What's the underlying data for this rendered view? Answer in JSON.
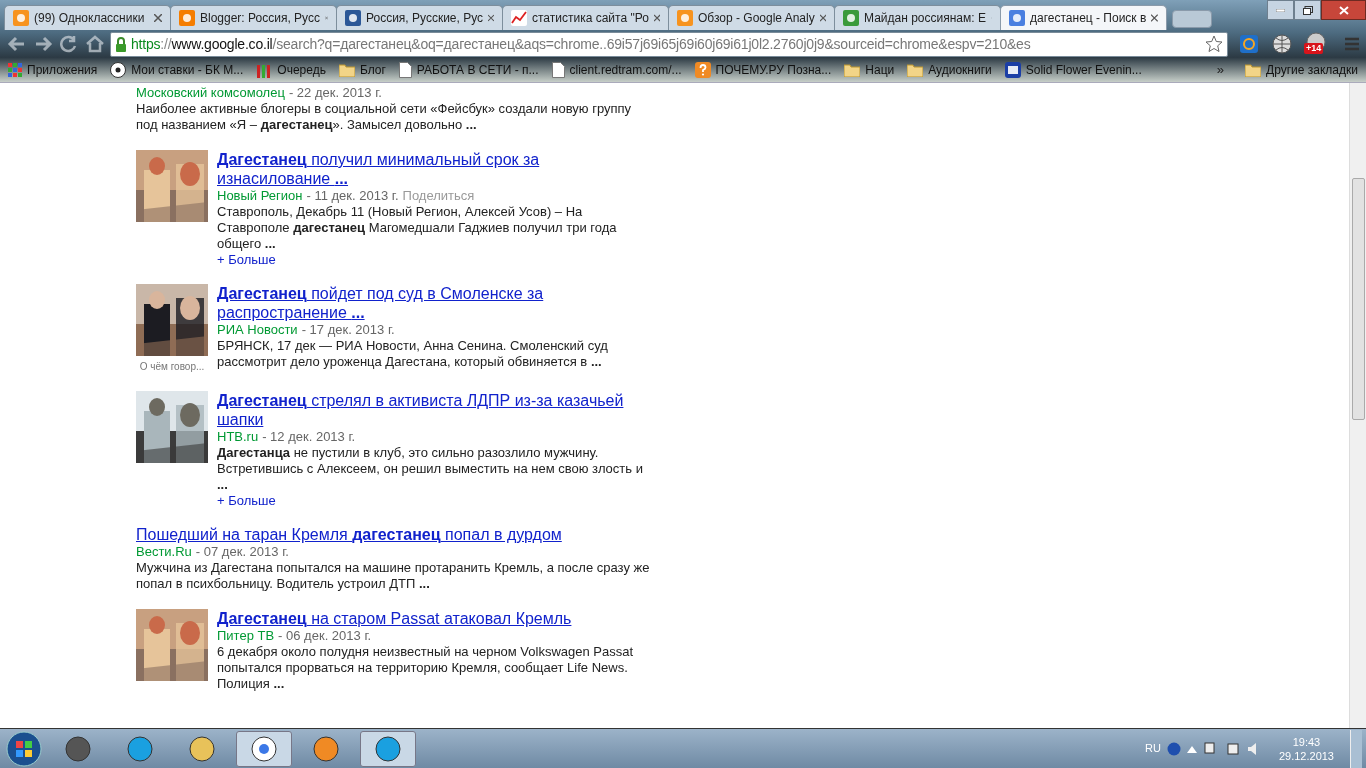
{
  "tabs": [
    {
      "title": "(99) Одноклассники",
      "selected": false
    },
    {
      "title": "Blogger: Россия, Русс",
      "selected": false
    },
    {
      "title": "Россия, Русские, Рус",
      "selected": false
    },
    {
      "title": "статистика сайта \"Ро",
      "selected": false
    },
    {
      "title": "Обзор - Google Analy",
      "selected": false
    },
    {
      "title": "Майдан россиянам: Е",
      "selected": false
    },
    {
      "title": "дагестанец - Поиск в",
      "selected": true
    }
  ],
  "address": {
    "scheme": "https",
    "separator": "://",
    "host": "www.google.co.il",
    "path": "/search?q=дагестанец&oq=дагестанец&aqs=chrome..69i57j69i65j69i60j69i61j0l2.2760j0j9&sourceid=chrome&espv=210&es"
  },
  "extension_badge": "+14",
  "bookmarks": [
    {
      "label": "Приложения"
    },
    {
      "label": "Мои ставки - БК М..."
    },
    {
      "label": "Очередь"
    },
    {
      "label": "Блог"
    },
    {
      "label": "РАБОТА В СЕТИ - п..."
    },
    {
      "label": "client.redtram.com/..."
    },
    {
      "label": "ПОЧЕМУ.РУ Позна..."
    },
    {
      "label": "Наци"
    },
    {
      "label": "Аудиокниги"
    },
    {
      "label": "Solid Flower Evenin..."
    }
  ],
  "bookmarks_more": "»",
  "other_bookmarks": "Другие закладки",
  "results": [
    {
      "source": "Московский комсомолец",
      "date": "- 22 дек. 2013 г.",
      "snippet": "Наиболее активные блогеры в социальной сети «Фейсбук» создали новую группу под названием «Я – **дагестанец**». Замысел довольно **...**"
    },
    {
      "thumbnail": true,
      "title": "**Дагестанец** получил минимальный срок за изнасилование **...**",
      "source": "Новый Регион",
      "date": "- 11 дек. 2013 г.",
      "share": "Поделиться",
      "snippet": "Ставрополь, Декабрь 11 (Новый Регион, Алексей Усов) – На Ставрополе **дагестанец** Магомедшали Гаджиев получил три года общего **...**",
      "more": "+ Больше"
    },
    {
      "thumbnail": true,
      "thumb_caption": "О чём говор...",
      "title": "**Дагестанец** пойдет под суд в Смоленске за распространение **...**",
      "source": "РИА Новости",
      "date": "- 17 дек. 2013 г.",
      "snippet": "БРЯНСК, 17 дек — РИА Новости, Анна Сенина. Смоленский суд рассмотрит дело уроженца Дагестана, который обвиняется в **...**"
    },
    {
      "thumbnail": true,
      "title": "**Дагестанец** стрелял в активиста ЛДПР из-за казачьей шапки",
      "source": "НТВ.ru",
      "date": "- 12 дек. 2013 г.",
      "snippet": "**Дагестанца** не пустили в клуб, это сильно разозлило мужчину. Встретившись с Алексеем, он решил выместить на нем свою злость и **...**",
      "more": "+ Больше"
    },
    {
      "title": "Пошедший на таран Кремля **дагестанец** попал в дурдом",
      "source": "Вести.Ru",
      "date": "- 07 дек. 2013 г.",
      "snippet": "Мужчина из Дагестана попытался на машине протаранить Кремль, а после сразу же попал в психбольницу. Водитель устроил ДТП **...**"
    },
    {
      "thumbnail": true,
      "title": "**Дагестанец** на старом Passat атаковал Кремль",
      "source": "Питер ТВ",
      "date": "- 06 дек. 2013 г.",
      "snippet": "6 декабря около полудня неизвестный на черном Volkswagen Passat попытался прорваться на территорию Кремля, сообщает Life News. Полиция **...**"
    }
  ],
  "taskbar": {
    "language": "RU",
    "time": "19:43",
    "date": "29.12.2013"
  }
}
